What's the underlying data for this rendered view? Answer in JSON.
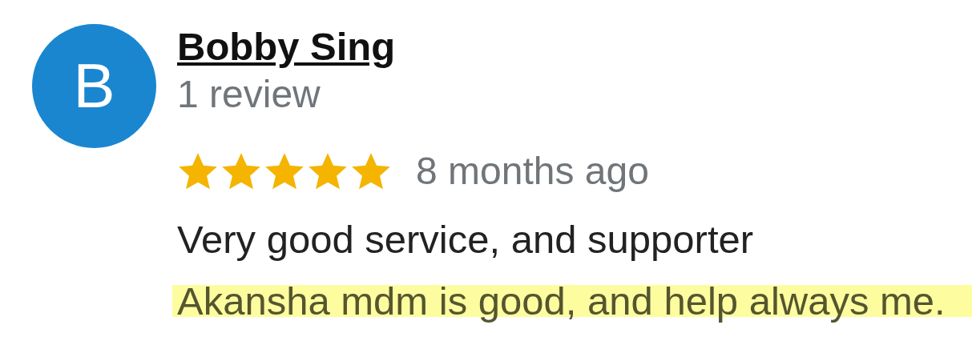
{
  "review": {
    "avatar_letter": "B",
    "author": "Bobby Sing",
    "review_count": "1 review",
    "stars": 5,
    "time": "8 months ago",
    "lines": [
      {
        "text": "Very good service, and supporter",
        "highlighted": false
      },
      {
        "text": "Akansha mdm is good, and help always me.",
        "highlighted": true
      }
    ]
  }
}
